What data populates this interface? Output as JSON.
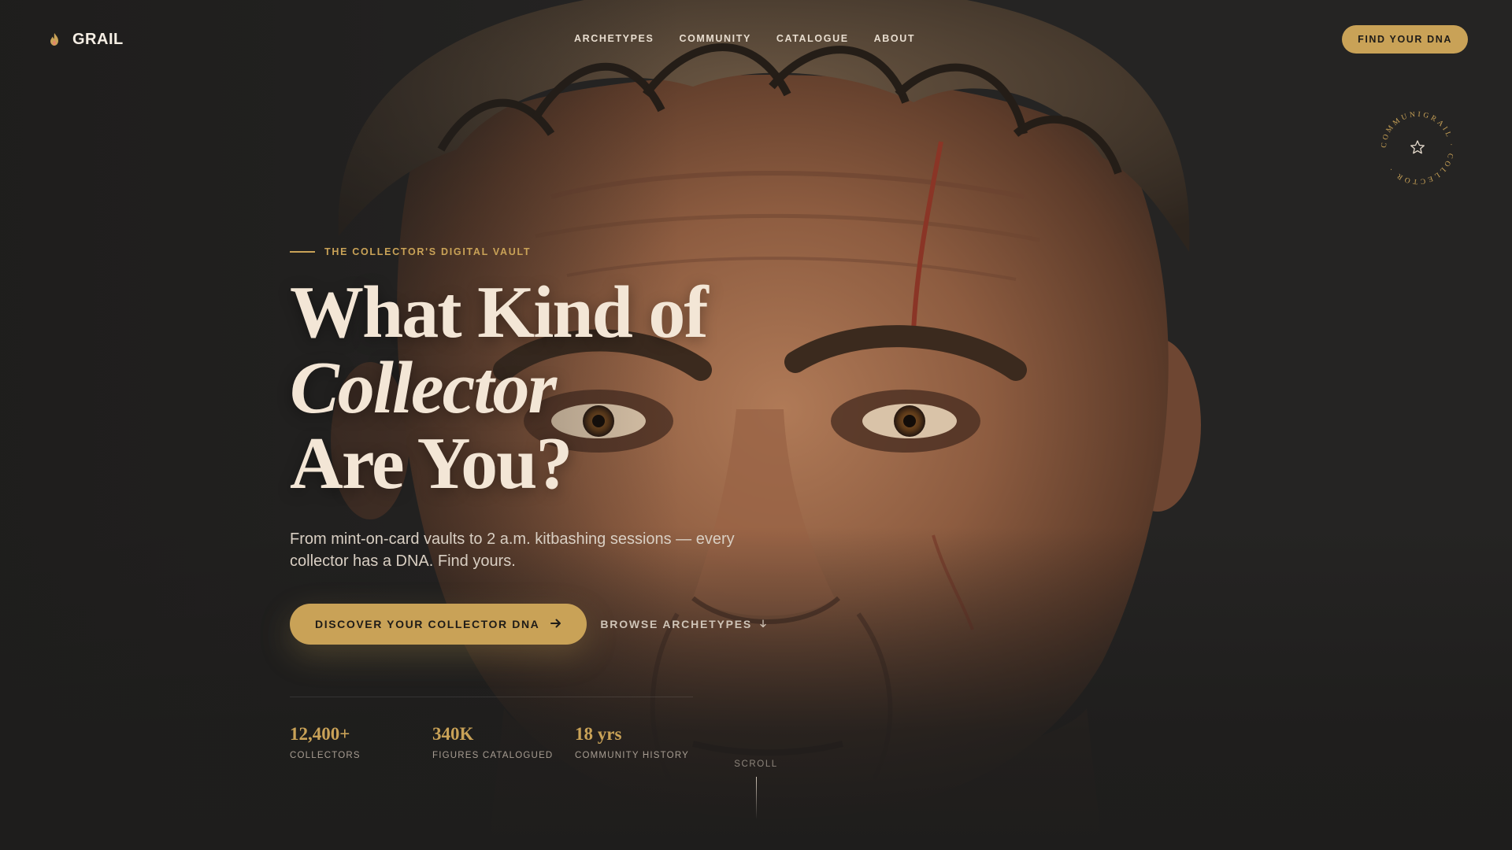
{
  "brand": {
    "name": "GRAIL",
    "icon": "flame-icon"
  },
  "nav": {
    "links": [
      "ARCHETYPES",
      "COMMUNITY",
      "CATALOGUE",
      "ABOUT"
    ],
    "cta_label": "FIND YOUR DNA"
  },
  "seal": {
    "text": "COMMUNIGRAIL · COLLECTOR ·",
    "icon": "star-icon"
  },
  "hero": {
    "eyebrow": "THE COLLECTOR'S DIGITAL VAULT",
    "headline_line1": "What Kind of",
    "headline_line2": "Collector",
    "headline_line3": "Are You?",
    "subcopy": "From mint-on-card vaults to 2 a.m. kitbashing sessions — every collector has a DNA. Find yours.",
    "primary_cta": "DISCOVER YOUR COLLECTOR DNA",
    "secondary_cta": "BROWSE ARCHETYPES"
  },
  "stats": [
    {
      "value": "12,400+",
      "label": "COLLECTORS"
    },
    {
      "value": "340K",
      "label": "FIGURES CATALOGUED"
    },
    {
      "value": "18 yrs",
      "label": "COMMUNITY HISTORY"
    }
  ],
  "scroll": {
    "label": "SCROLL"
  },
  "colors": {
    "background": "#252423",
    "accent": "#c9a257",
    "text": "#f3e6d6"
  }
}
